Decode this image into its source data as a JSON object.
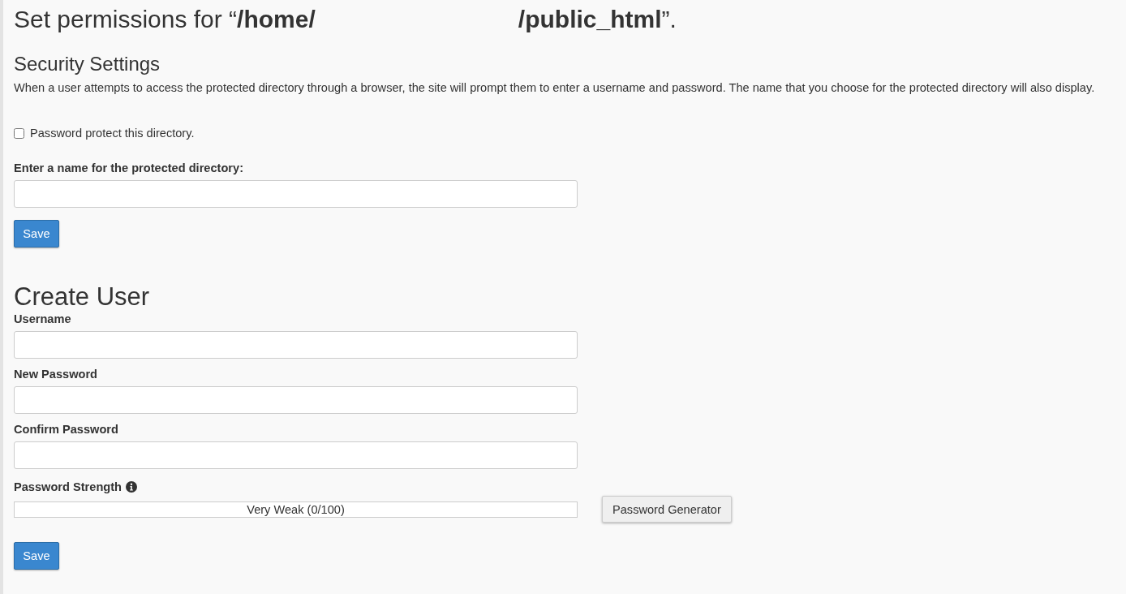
{
  "title": "Set permissions for “**/home/                              /public_html**”.",
  "security_settings": {
    "heading": "Security Settings",
    "description": "When a user attempts to access the protected directory through a browser, the site will prompt them to enter a username and password. The name that you choose for the protected directory will also display.",
    "protect_checkbox": {
      "label": "Password protect this directory.",
      "checked": false
    },
    "directory_name": {
      "label": "Enter a name for the protected directory:"
    },
    "save_button": "Save"
  },
  "create_user": {
    "heading": "Create User",
    "fields": [
      {
        "label": "Username"
      },
      {
        "label": "New Password"
      },
      {
        "label": "Confirm Password"
      }
    ],
    "strength": {
      "label": "Password Strength",
      "reading": "Very Weak (0/100)"
    },
    "generator_button": "Password Generator",
    "save_button": "Save"
  }
}
